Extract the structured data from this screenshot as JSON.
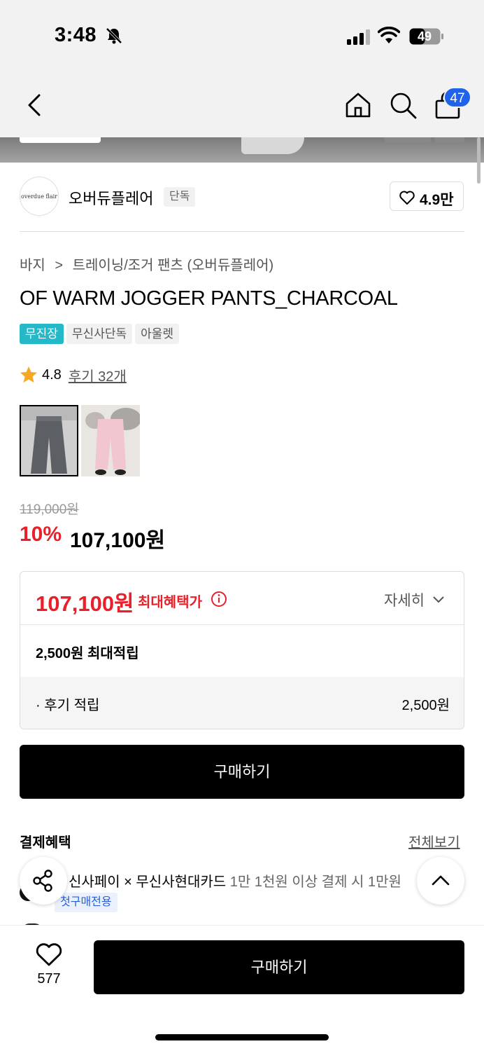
{
  "status_bar": {
    "time": "3:48",
    "battery": "49"
  },
  "nav": {
    "cart_count": "47"
  },
  "brand": {
    "logo_text": "overdue flair",
    "name": "오버듀플레어",
    "exclusive_tag": "단독",
    "likes": "4.9만"
  },
  "product": {
    "breadcrumb": [
      "바지",
      ">",
      "트레이닝/조거 팬츠 (오버듀플레어)"
    ],
    "title": "OF WARM JOGGER PANTS_CHARCOAL",
    "tags": [
      "무진장",
      "무신사단독",
      "아울렛"
    ],
    "rating": "4.8",
    "review_link": "후기 32개",
    "original_price": "119,000원",
    "discount_rate": "10%",
    "sale_price": "107,100원"
  },
  "benefit": {
    "max_price": "107,100원",
    "max_label": "최대혜택가",
    "detail_label": "자세히",
    "points": "2,500원 최대적립",
    "review_points_label": "· 후기 적립",
    "review_points_value": "2,500원"
  },
  "buy_label": "구매하기",
  "payment": {
    "title": "결제혜택",
    "view_all": "전체보기",
    "offer_name": "신사페이 × 무신사현대카드",
    "offer_desc": " 1만 1천원 이상 결제 시 1만원",
    "offer_tag": "첫구매전용"
  },
  "bottom": {
    "like_count": "577",
    "buy_label": "구매하기"
  },
  "colors": {
    "accent_red": "#e8202a",
    "tag_teal": "#24b8c9",
    "badge_blue": "#1e63e9"
  }
}
